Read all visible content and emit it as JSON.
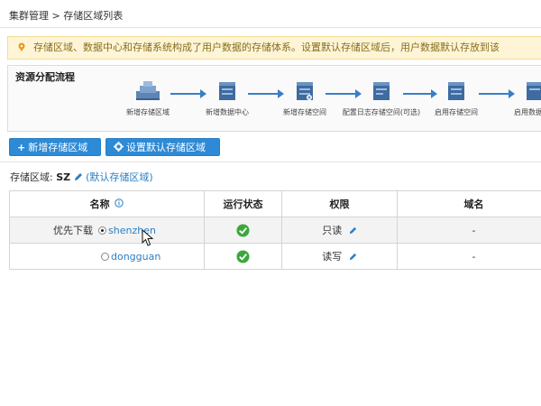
{
  "breadcrumb": {
    "parent": "集群管理",
    "separator": ">",
    "current": "存储区域列表"
  },
  "notice": {
    "text": "存储区域、数据中心和存储系统构成了用户数据的存储体系。设置默认存储区域后，用户数据默认存放到该"
  },
  "flow": {
    "title": "资源分配流程",
    "steps": [
      {
        "label": "新增存储区域",
        "icon": "storage-zone-icon"
      },
      {
        "label": "新增数据中心",
        "icon": "datacenter-icon"
      },
      {
        "label": "新增存储空间",
        "icon": "storage-space-icon"
      },
      {
        "label": "配置日志存储空间(可选)",
        "icon": "log-storage-icon"
      },
      {
        "label": "启用存储空间",
        "icon": "enable-storage-icon"
      },
      {
        "label": "启用数据",
        "icon": "enable-data-icon"
      }
    ]
  },
  "toolbar": {
    "add_label": "新增存储区域",
    "add_symbol": "+",
    "set_default_label": "设置默认存储区域"
  },
  "zone": {
    "prefix": "存储区域:",
    "name": "SZ",
    "default_label": "(默认存储区域)"
  },
  "table": {
    "headers": {
      "name": "名称",
      "status": "运行状态",
      "permission": "权限",
      "domain": "域名"
    },
    "rows": [
      {
        "priority": "优先下载",
        "name": "shenzhen",
        "selected": true,
        "permission": "只读",
        "domain": "-"
      },
      {
        "priority": "",
        "name": "dongguan",
        "selected": false,
        "permission": "读写",
        "domain": "-"
      }
    ]
  },
  "colors": {
    "accent": "#2d8ad6",
    "link": "#2a7fc4",
    "notice_bg": "#fdf5d6",
    "ok_green": "#3aa83a"
  }
}
